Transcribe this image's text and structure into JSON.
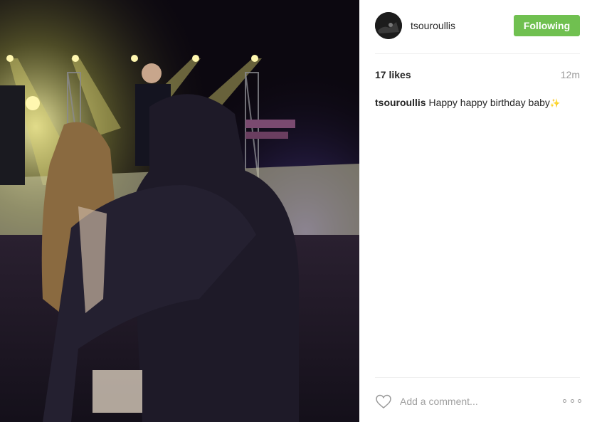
{
  "post": {
    "image_icon": "concert-photo",
    "author": {
      "username": "tsouroullis",
      "avatar_icon": "user-avatar"
    },
    "follow_label": "Following",
    "likes_text": "17 likes",
    "time_ago": "12m",
    "caption": {
      "username": "tsouroullis",
      "text": "Happy happy birthday baby",
      "emoji": "✨"
    },
    "comment_placeholder": "Add a comment...",
    "icons": {
      "like": "heart-icon",
      "more": "more-options-icon"
    },
    "colors": {
      "follow_button": "#70c050",
      "muted_text": "#999999",
      "divider": "#efefef"
    }
  }
}
